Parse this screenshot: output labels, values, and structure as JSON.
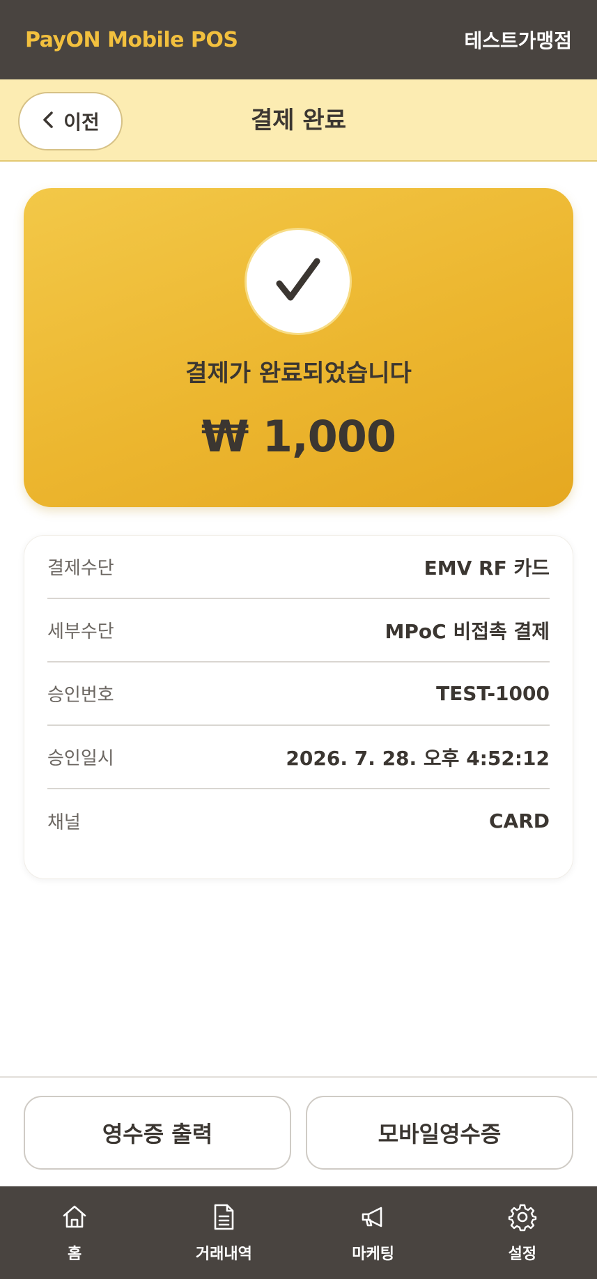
{
  "header": {
    "brand": "PayON Mobile POS",
    "store_name": "테스트가맹점"
  },
  "subheader": {
    "back_label": "이전",
    "title": "결제 완료"
  },
  "result": {
    "message": "결제가 완료되었습니다",
    "amount": "₩ 1,000",
    "icon": "check-icon"
  },
  "details": [
    {
      "label": "결제수단",
      "value": "EMV RF 카드"
    },
    {
      "label": "세부수단",
      "value": "MPoC 비접촉 결제"
    },
    {
      "label": "승인번호",
      "value": "TEST-1000"
    },
    {
      "label": "승인일시",
      "value": "2026. 7. 28. 오후 4:52:12"
    },
    {
      "label": "채널",
      "value": "CARD"
    }
  ],
  "actions": {
    "print_receipt": "영수증 출력",
    "mobile_receipt": "모바일영수증"
  },
  "tabbar": [
    {
      "label": "홈",
      "icon": "home-icon"
    },
    {
      "label": "거래내역",
      "icon": "document-icon"
    },
    {
      "label": "마케팅",
      "icon": "megaphone-icon"
    },
    {
      "label": "설정",
      "icon": "gear-icon"
    }
  ],
  "colors": {
    "topbar_bg": "#494440",
    "brand": "#f2c03e",
    "subbar_bg": "#fcecb2",
    "card_gold": "#ecb62f",
    "text_dark": "#3b3631"
  }
}
